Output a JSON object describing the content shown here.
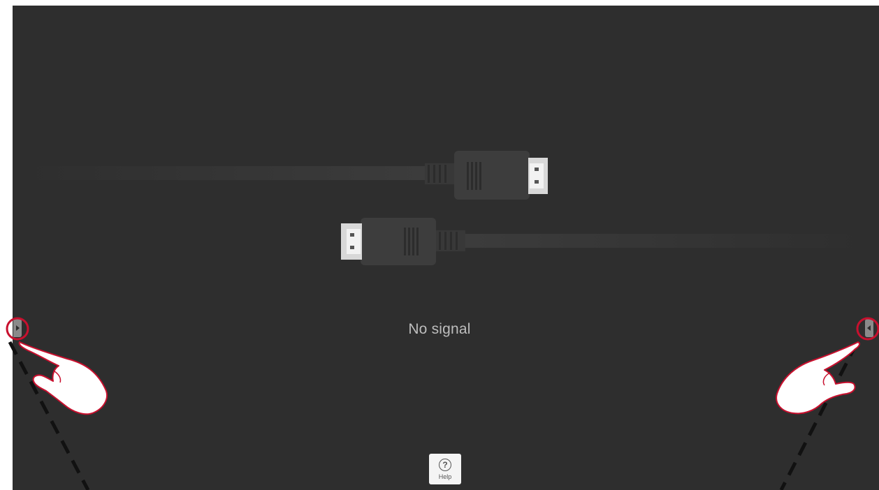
{
  "screen": {
    "status_text": "No signal"
  },
  "help": {
    "label": "Help",
    "icon": "question-circle-icon"
  },
  "edge_tabs": {
    "left_icon": "chevron-right-icon",
    "right_icon": "chevron-left-icon"
  },
  "colors": {
    "background": "#2e2e2e",
    "highlight_ring": "#c8102e",
    "cable": "#3a3a3a"
  }
}
